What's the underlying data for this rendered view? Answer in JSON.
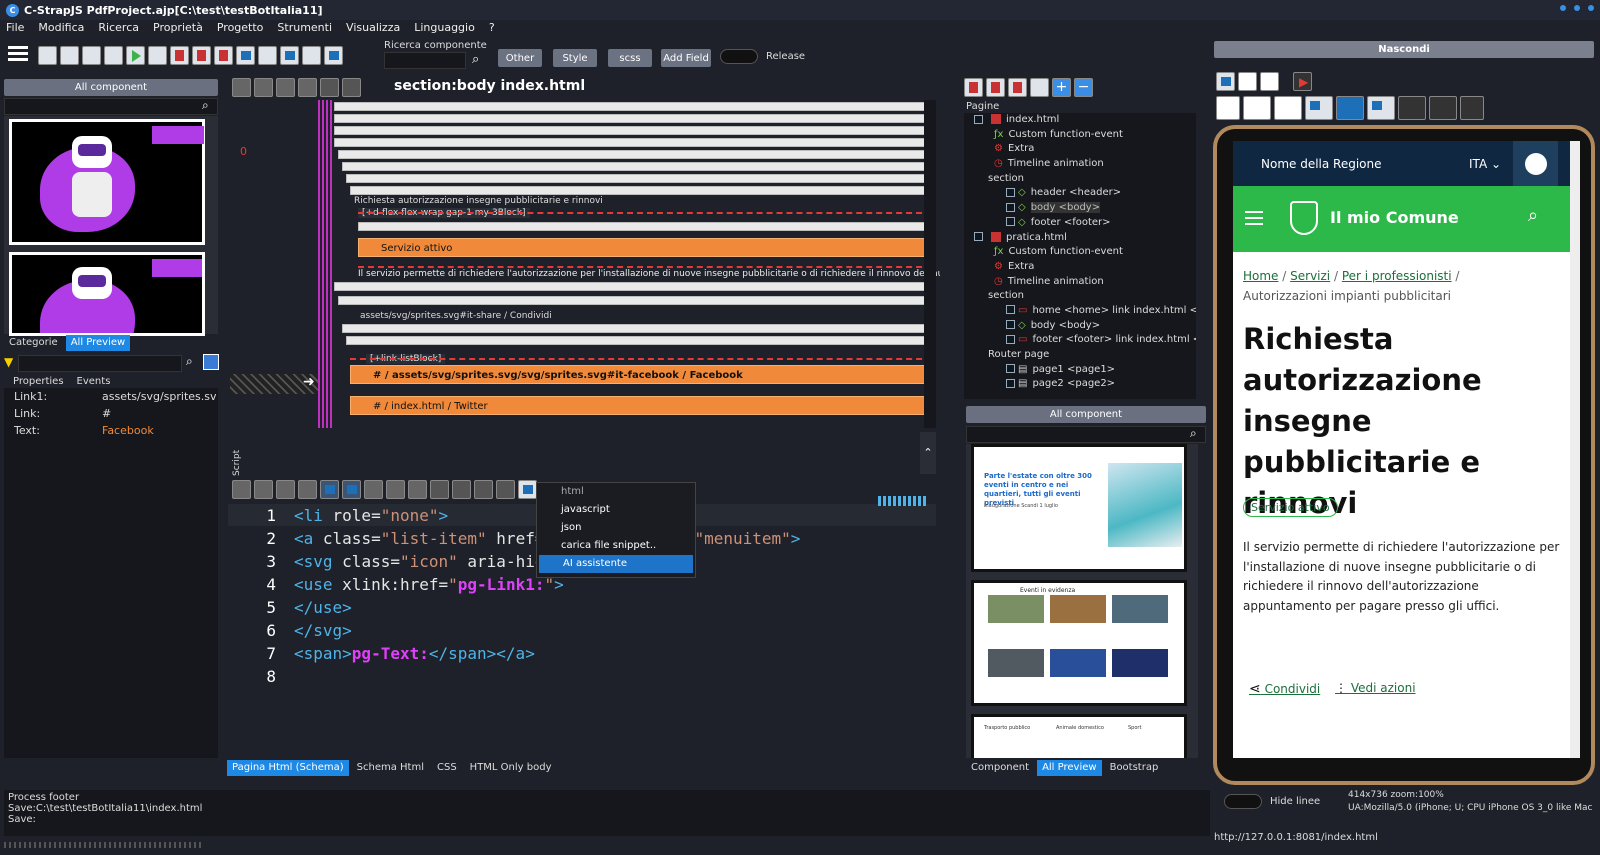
{
  "window": {
    "title": "C-StrapJS PdfProject.ajp[C:\\test\\testBotItalia11]"
  },
  "menu": [
    "File",
    "Modifica",
    "Ricerca",
    "Proprietà",
    "Progetto",
    "Strumenti",
    "Visualizza",
    "Linguaggio",
    "?"
  ],
  "toolbar": {
    "search_label": "Ricerca componente",
    "other": "Other",
    "style": "Style",
    "scss": "scss",
    "add_field": "Add Field",
    "release": "Release"
  },
  "left": {
    "all_component": "All component",
    "tab_categorie": "Categorie",
    "tab_preview": "All Preview",
    "tab_properties": "Properties",
    "tab_events": "Events",
    "props": [
      {
        "k": "Link1:",
        "v": "assets/svg/sprites.svg/sv"
      },
      {
        "k": "Link:",
        "v": "#"
      },
      {
        "k": "Text:",
        "v": "Facebook"
      }
    ]
  },
  "center": {
    "title": "section:body index.html",
    "zero": "0",
    "script_label": "Script",
    "rows": {
      "r1": "Richiesta autorizzazione insegne pubblicitarie e rinnovi",
      "r2": "[+d-flex flex-wrap gap-1 my-3Block]",
      "r3": "Servizio attivo",
      "r4": "Il servizio permette di richiedere l'autorizzazione per l'installazione di nuove insegne pubblicitarie o di richiedere il rinnovo dell'autorizzazione /",
      "r5": "assets/svg/sprites.svg#it-share / Condividi",
      "r6": "[+link-listBlock]",
      "r7": "# / assets/svg/sprites.svg/svg/sprites.svg#it-facebook / Facebook",
      "r8": "# / index.html / Twitter"
    }
  },
  "editor": {
    "lines": [
      "1",
      "2",
      "3",
      "4",
      "5",
      "6",
      "7",
      "8"
    ],
    "popup": [
      "html",
      "javascript",
      "json",
      "carica file snippet..",
      "AI assistente"
    ],
    "bottom_tabs": [
      "Pagina Html (Schema)",
      "Schema Html",
      "CSS",
      "HTML Only body"
    ]
  },
  "right": {
    "pagine": "Pagine",
    "all_component": "All component",
    "tabs": [
      "Component",
      "All Preview",
      "Bootstrap"
    ],
    "tree": [
      "index.html",
      "Custom function-event",
      "Extra",
      "Timeline animation",
      "section",
      "header <header>",
      "body <body>",
      "footer <footer>",
      "pratica.html",
      "Custom function-event",
      "Extra",
      "Timeline animation",
      "section",
      "home <home> link index.html <heade",
      "body <body>",
      "footer <footer> link index.html <foot",
      "Router page",
      "page1 <page1>",
      "page2 <page2>"
    ],
    "thumb": {
      "a_title": "Parte l'estate con oltre 300 eventi in centro e nei quartieri, tutti gli eventi previsti",
      "a_sub": "Inaugurazione Scandi 1 luglio",
      "b_title": "Eventi in evidenza",
      "c1": "Trasporto pubblico",
      "c2": "Animale domestico",
      "c3": "Sport"
    }
  },
  "preview": {
    "hide": "Nascondi",
    "region": "Nome della Regione",
    "lang": "ITA",
    "comune": "Il mio Comune",
    "bc": [
      "Home",
      "Servizi",
      "Per i professionisti"
    ],
    "bc_last": "Autorizzazioni impianti pubblicitari",
    "h1": "Richiesta autorizzazione insegne pubblicitarie e rinnovi",
    "badge": "Servizio attivo",
    "desc": "Il servizio permette di richiedere l'autorizzazione per l'installazione di nuove insegne pubblicitarie o di richiedere il rinnovo dell'autorizzazione appuntamento per pagare presso gli uffici.",
    "share": "Condividi",
    "actions": "Vedi azioni",
    "hide_lines": "Hide linee",
    "size": "414x736 zoom:100%",
    "ua": "UA:Mozilla/5.0 (iPhone; U; CPU iPhone OS 3_0 like Mac",
    "url": "http://127.0.0.1:8081/index.html"
  },
  "status": {
    "l1": "Process footer",
    "l2": "Save:C:\\test\\testBotItalia11\\index.html",
    "l3": "Save:"
  },
  "colors": {
    "accent": "#1e88e5",
    "green": "#2db84a",
    "orange": "#f08a3a"
  }
}
